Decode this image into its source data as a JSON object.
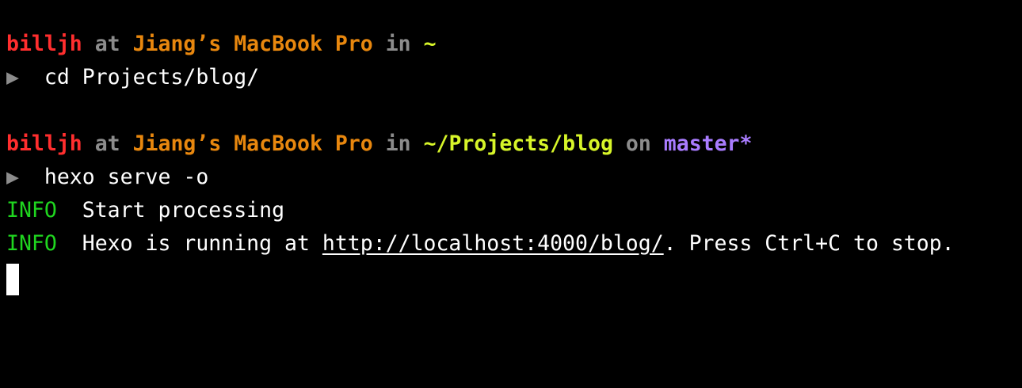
{
  "prompt1": {
    "user": "billjh",
    "at": "at",
    "host": "Jiang’s MacBook Pro",
    "in": "in",
    "dir": "~"
  },
  "command1": {
    "arrow": "▶",
    "text": "cd Projects/blog/"
  },
  "prompt2": {
    "user": "billjh",
    "at": "at",
    "host": "Jiang’s MacBook Pro",
    "in": "in",
    "dir": "~/Projects/blog",
    "on": "on",
    "branch": "master*"
  },
  "command2": {
    "arrow": "▶",
    "text": "hexo serve -o"
  },
  "output": [
    {
      "level": "INFO",
      "message": "Start processing"
    },
    {
      "level": "INFO",
      "message_before": "Hexo is running at ",
      "link": "http://localhost:4000/blog/",
      "message_after": ". Press Ctrl+C to stop."
    }
  ],
  "colors": {
    "background": "#000000",
    "user": "#ff2e2e",
    "dim": "#8c8c8c",
    "host": "#e8870e",
    "directory": "#d7f529",
    "branch": "#a97cff",
    "info": "#1fd61f",
    "text": "#ffffff"
  }
}
